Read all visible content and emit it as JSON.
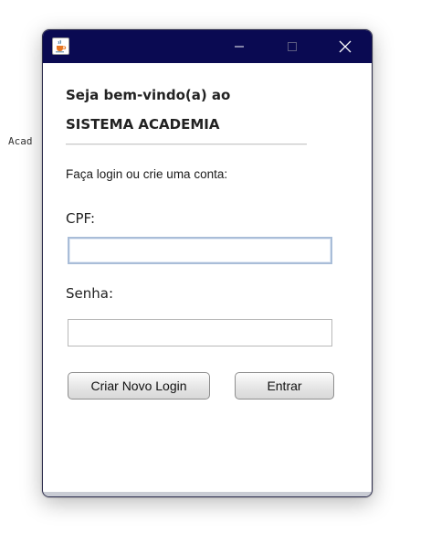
{
  "background": {
    "partial_text": "Acad"
  },
  "window": {
    "titlebar_color": "#0a0a52",
    "app_icon": "java-cup-icon",
    "controls": {
      "minimize": "minimize-icon",
      "maximize": "maximize-icon",
      "close": "close-icon"
    }
  },
  "form": {
    "welcome_line1": "Seja bem-vindo(a) ao",
    "welcome_line2": "SISTEMA ACADEMIA",
    "prompt": "Faça login ou crie uma conta:",
    "cpf_label": "CPF:",
    "cpf_value": "",
    "senha_label": "Senha:",
    "senha_value": "",
    "create_button": "Criar Novo Login",
    "enter_button": "Entrar"
  }
}
